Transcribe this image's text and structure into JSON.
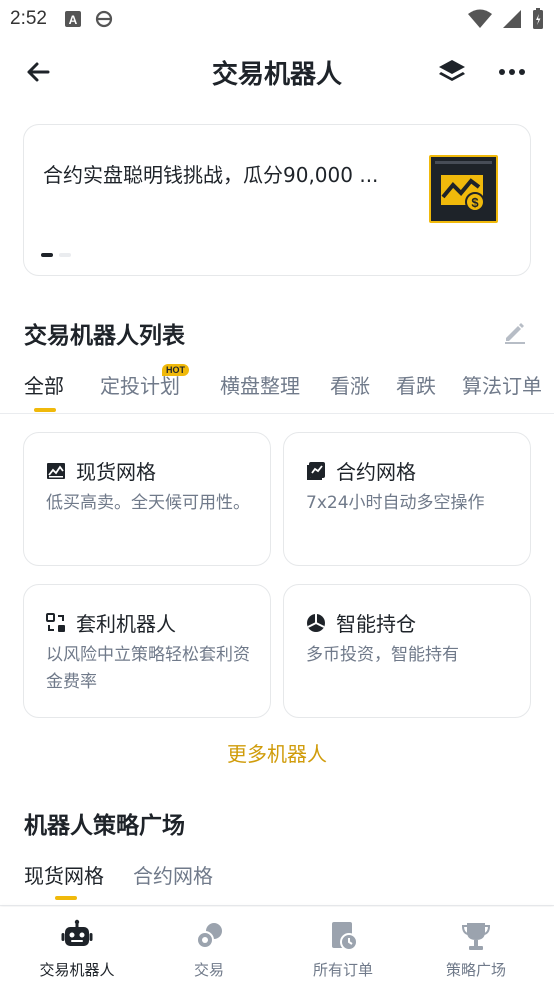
{
  "status_bar": {
    "time": "2:52"
  },
  "header": {
    "title": "交易机器人"
  },
  "banner": {
    "text": "合约实盘聪明钱挑战，瓜分90,000 ..."
  },
  "robot_list": {
    "title": "交易机器人列表",
    "tabs": [
      {
        "label": "全部",
        "active": true
      },
      {
        "label": "定投计划",
        "badge": "HOT"
      },
      {
        "label": "横盘整理"
      },
      {
        "label": "看涨"
      },
      {
        "label": "看跌"
      },
      {
        "label": "算法订单"
      }
    ],
    "cards": [
      {
        "title": "现货网格",
        "desc": "低买高卖。全天候可用性。",
        "icon": "spot-grid-icon"
      },
      {
        "title": "合约网格",
        "desc": "7x24小时自动多空操作",
        "icon": "futures-grid-icon"
      },
      {
        "title": "套利机器人",
        "desc": "以风险中立策略轻松套利资金费率",
        "icon": "arbitrage-icon"
      },
      {
        "title": "智能持仓",
        "desc": "多币投资，智能持有",
        "icon": "portfolio-icon"
      }
    ],
    "more_label": "更多机器人"
  },
  "strategy_square": {
    "title": "机器人策略广场",
    "tabs": [
      {
        "label": "现货网格",
        "active": true
      },
      {
        "label": "合约网格"
      }
    ]
  },
  "bottom_nav": [
    {
      "label": "交易机器人",
      "icon": "robot-icon",
      "active": true
    },
    {
      "label": "交易",
      "icon": "trade-icon"
    },
    {
      "label": "所有订单",
      "icon": "orders-icon"
    },
    {
      "label": "策略广场",
      "icon": "trophy-icon"
    }
  ],
  "colors": {
    "accent": "#f0b90b",
    "text_primary": "#1e2329",
    "text_secondary": "#707a8a",
    "link": "#d09c0b"
  }
}
